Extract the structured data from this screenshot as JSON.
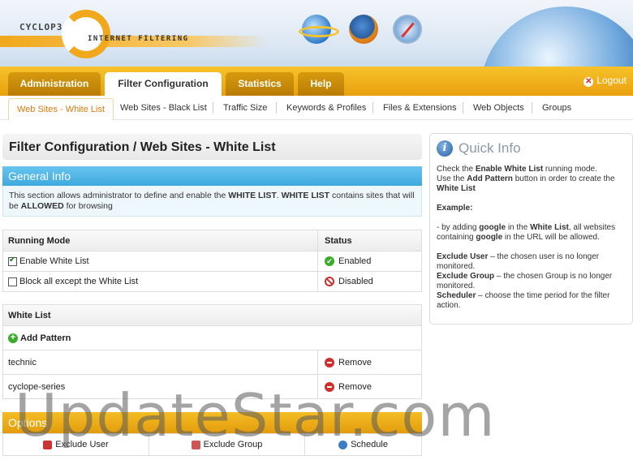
{
  "header": {
    "logo_text": "CYCLOP3",
    "logo_subtitle": "INTERNET FILTERING",
    "browsers": [
      "ie-icon",
      "firefox-icon",
      "safari-icon"
    ]
  },
  "nav": {
    "tabs": [
      {
        "label": "Administration",
        "active": false
      },
      {
        "label": "Filter Configuration",
        "active": true
      },
      {
        "label": "Statistics",
        "active": false
      },
      {
        "label": "Help",
        "active": false
      }
    ],
    "logout_label": "Logout"
  },
  "subnav": {
    "items": [
      {
        "label": "Web Sites - White List",
        "active": true
      },
      {
        "label": "Web Sites - Black List"
      },
      {
        "label": "Traffic Size"
      },
      {
        "label": "Keywords & Profiles"
      },
      {
        "label": "Files & Extensions"
      },
      {
        "label": "Web Objects"
      },
      {
        "label": "Groups"
      }
    ]
  },
  "page_title": "Filter Configuration / Web Sites - White List",
  "general_info": {
    "title": "General Info",
    "text_1": "This section allows administrator to define and enable the ",
    "bold_1": "WHITE LIST",
    "text_2": ". ",
    "bold_2": "WHITE LIST",
    "text_3": " contains sites that will be ",
    "bold_3": "ALLOWED",
    "text_4": " for browsing"
  },
  "running_mode": {
    "col_mode": "Running Mode",
    "col_status": "Status",
    "rows": [
      {
        "label": "Enable White List",
        "checked": true,
        "status": "Enabled"
      },
      {
        "label": "Block all except the White List",
        "checked": false,
        "status": "Disabled"
      }
    ]
  },
  "white_list": {
    "title": "White List",
    "add_label": "Add Pattern",
    "items": [
      {
        "pattern": "technic",
        "action": "Remove"
      },
      {
        "pattern": "cyclope-series",
        "action": "Remove"
      }
    ]
  },
  "options": {
    "title": "Options",
    "buttons": [
      "Exclude User",
      "Exclude Group",
      "Schedule"
    ]
  },
  "quick_info": {
    "title": "Quick Info",
    "p1_a": "Check the ",
    "p1_b": "Enable White List",
    "p1_c": " running mode.",
    "p2_a": "Use the ",
    "p2_b": "Add Pattern",
    "p2_c": " button in order to create the ",
    "p2_d": "White List",
    "example": "Example:",
    "p3_a": "- by adding ",
    "p3_b": "google",
    "p3_c": " in the ",
    "p3_d": "White List",
    "p3_e": ", all websites containing ",
    "p3_f": "google",
    "p3_g": " in the URL will be allowed.",
    "exclude_user_b": "Exclude User",
    "exclude_user_t": " – the chosen user is no longer monitored.",
    "exclude_group_b": "Exclude Group",
    "exclude_group_t": " – the chosen Group is no longer monitored.",
    "scheduler_b": "Scheduler",
    "scheduler_t": " – choose the time period for the filter action."
  },
  "watermark": "UpdateStar.com"
}
